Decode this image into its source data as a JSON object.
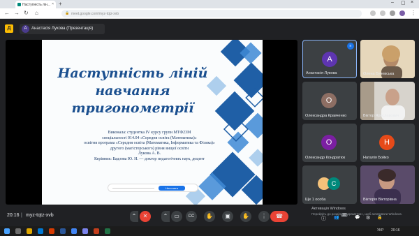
{
  "browser": {
    "tab_title": "Наступність лін...",
    "url": "meet.google.com/myz-tqtz-xvb"
  },
  "header": {
    "logo": "Д",
    "presenter_initial": "А",
    "presenter_label": "Анастасія Лукова (Презентація)"
  },
  "slide": {
    "title_line1": "Наступність ліній",
    "title_line2": "навчання тригонометрії",
    "body_lines": [
      "Виконала: студентка IV курсу групи МТФ23М",
      "спеціальності 014.04 «Середня освіта (Математика)»",
      "освітня програма «Середня освіта (Математика, Інформатика та Фізика)»",
      "другого (магістерського) рівня вищої освіти",
      "Лукова А. В.",
      "Керівник: Бадзова Ю. Н. — доктор педагогічних наук, доцент"
    ],
    "toolbar_button": "Непочата презентація"
  },
  "participants": [
    {
      "name": "Анастасія Лукова",
      "initial": "А",
      "color": "#5e35b1",
      "video": false,
      "speaking": true
    },
    {
      "name": "Олена Бучевська",
      "initial": "",
      "color": "",
      "video": true,
      "speaking": false
    },
    {
      "name": "Олександра Кравченко",
      "initial": "О",
      "color": "#8d6e63",
      "video": false,
      "speaking": false
    },
    {
      "name": "Віктор Ярославович",
      "initial": "",
      "color": "",
      "video": true,
      "speaking": false
    },
    {
      "name": "Олександр Кондратюк",
      "initial": "О",
      "color": "#7b1fa2",
      "video": false,
      "speaking": false
    },
    {
      "name": "Наталія Бойко",
      "initial": "Н",
      "color": "#e64a19",
      "video": false,
      "speaking": false
    },
    {
      "name": "Ще 1 особа",
      "initial": "С",
      "color": "#00897b",
      "video": false,
      "speaking": false
    },
    {
      "name": "Вікторія Вікторівна",
      "initial": "",
      "color": "",
      "video": true,
      "speaking": false
    }
  ],
  "bottom": {
    "time": "20:16",
    "separator": "|",
    "meeting_code": "myz-tqtz-xvb",
    "activate_title": "Активація Windows",
    "activate_sub": "Перейдіть до розділу «Параметри», щоб активувати Windows."
  },
  "controls": {
    "expand": "⌃",
    "mic_off": "✕",
    "camera": "▭",
    "captions": "CC",
    "raise_hand": "✋",
    "present": "▣",
    "more": "⋮",
    "hangup": "☎"
  },
  "right_controls": {
    "info": "ⓘ",
    "people": "👥",
    "chat": "💬",
    "activities": "⚙",
    "lock": "🔒",
    "people_count": "10"
  },
  "taskbar": {
    "tray_text": "УКР",
    "tray_time": "20:16"
  },
  "colors": {
    "meet_bg": "#202124",
    "tile_bg": "#3c4043",
    "accent": "#1a73e8",
    "danger": "#ea4335",
    "slide_title": "#1a4f8f"
  }
}
